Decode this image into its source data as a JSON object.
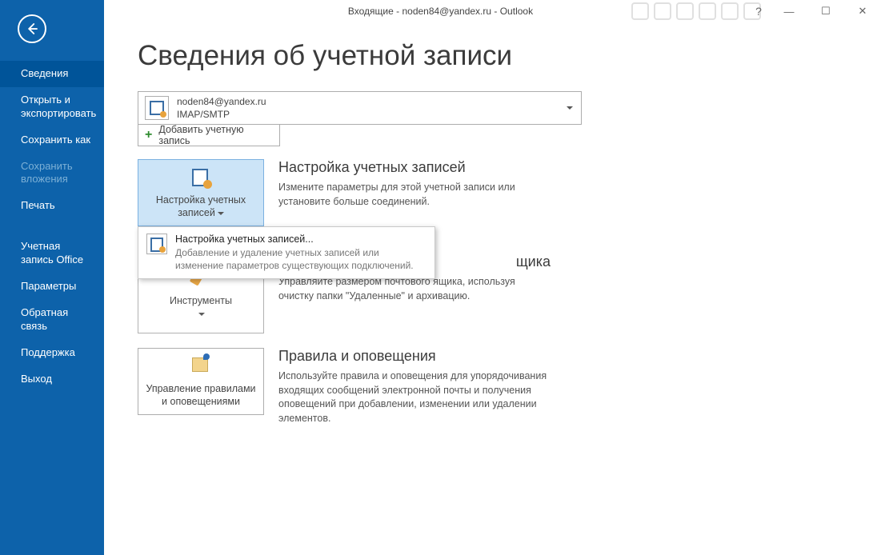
{
  "titlebar": {
    "title": "Входящие - noden84@yandex.ru - Outlook",
    "help": "?",
    "minimize": "—",
    "maximize": "☐",
    "close": "✕"
  },
  "sidebar": {
    "back_label": "Back",
    "items": [
      {
        "label": "Сведения",
        "selected": true
      },
      {
        "label": "Открыть и экспортировать"
      },
      {
        "label": "Сохранить как"
      },
      {
        "label": "Сохранить вложения",
        "disabled": true
      },
      {
        "label": "Печать"
      }
    ],
    "lower": [
      {
        "label": "Учетная запись Office"
      },
      {
        "label": "Параметры"
      },
      {
        "label": "Обратная связь"
      },
      {
        "label": "Поддержка"
      },
      {
        "label": "Выход"
      }
    ]
  },
  "page": {
    "title": "Сведения об учетной записи"
  },
  "account": {
    "email": "noden84@yandex.ru",
    "protocol": "IMAP/SMTP",
    "add_label": "Добавить учетную запись"
  },
  "tiles": {
    "account_settings": {
      "button": "Настройка учетных записей",
      "heading": "Настройка учетных записей",
      "desc": "Измените параметры для этой учетной записи или установите больше соединений."
    },
    "dropdown": {
      "title": "Настройка учетных записей...",
      "sub": "Добавление и удаление учетных записей или изменение параметров существующих подключений."
    },
    "mailbox": {
      "button": "Инструменты",
      "heading": "щика",
      "desc": "Управляйте размером почтового ящика, используя очистку папки \"Удаленные\" и архивацию."
    },
    "rules": {
      "button": "Управление правилами и оповещениями",
      "heading": "Правила и оповещения",
      "desc": "Используйте правила и оповещения для упорядочивания входящих сообщений электронной почты и получения оповещений при добавлении, изменении или удалении элементов."
    }
  }
}
